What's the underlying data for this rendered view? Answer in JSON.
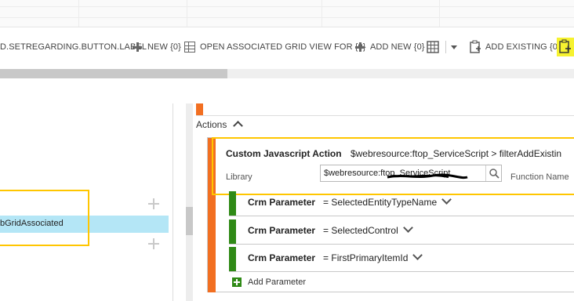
{
  "ribbon": {
    "items": [
      {
        "label": "D.SETREGARDING.BUTTON.LABEL"
      },
      {
        "label": "NEW {0}"
      },
      {
        "label": "OPEN ASSOCIATED GRID VIEW FOR {0}"
      },
      {
        "label": "ADD NEW {0}"
      },
      {
        "label": "ADD EXISTING {0}"
      }
    ]
  },
  "left_panel": {
    "selected_item": "bGridAssociated"
  },
  "actions": {
    "header": "Actions",
    "custom_action": {
      "title": "Custom Javascript Action",
      "summary": "$webresource:ftop_ServiceScript > filterAddExistin",
      "library_label": "Library",
      "library_value": "$webresource:ftop_ServiceScript",
      "function_label": "Function Name"
    },
    "parameters": [
      {
        "label": "Crm Parameter",
        "value": "= SelectedEntityTypeName"
      },
      {
        "label": "Crm Parameter",
        "value": "= SelectedControl"
      },
      {
        "label": "Crm Parameter",
        "value": "= FirstPrimaryItemId"
      }
    ],
    "add_parameter": "Add Parameter"
  },
  "colors": {
    "accent_orange": "#f26f21",
    "param_green": "#2f8a16",
    "highlight_yellow": "#ffc600",
    "selection_blue": "#b4e6f6"
  }
}
